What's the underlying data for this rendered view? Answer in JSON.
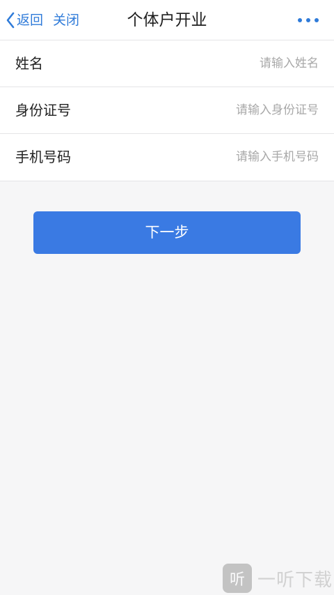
{
  "nav": {
    "back_label": "返回",
    "close_label": "关闭",
    "title": "个体户开业",
    "more_icon": "more-horizontal-icon",
    "back_icon": "chevron-left-icon"
  },
  "form": {
    "fields": [
      {
        "label": "姓名",
        "placeholder": "请输入姓名",
        "value": ""
      },
      {
        "label": "身份证号",
        "placeholder": "请输入身份证号",
        "value": ""
      },
      {
        "label": "手机号码",
        "placeholder": "请输入手机号码",
        "value": ""
      }
    ]
  },
  "actions": {
    "next_label": "下一步"
  },
  "watermark": {
    "logo_char": "听",
    "text": "一听下载"
  },
  "colors": {
    "accent": "#2f7bd9",
    "button": "#3a7ae3",
    "background": "#f6f6f7"
  }
}
